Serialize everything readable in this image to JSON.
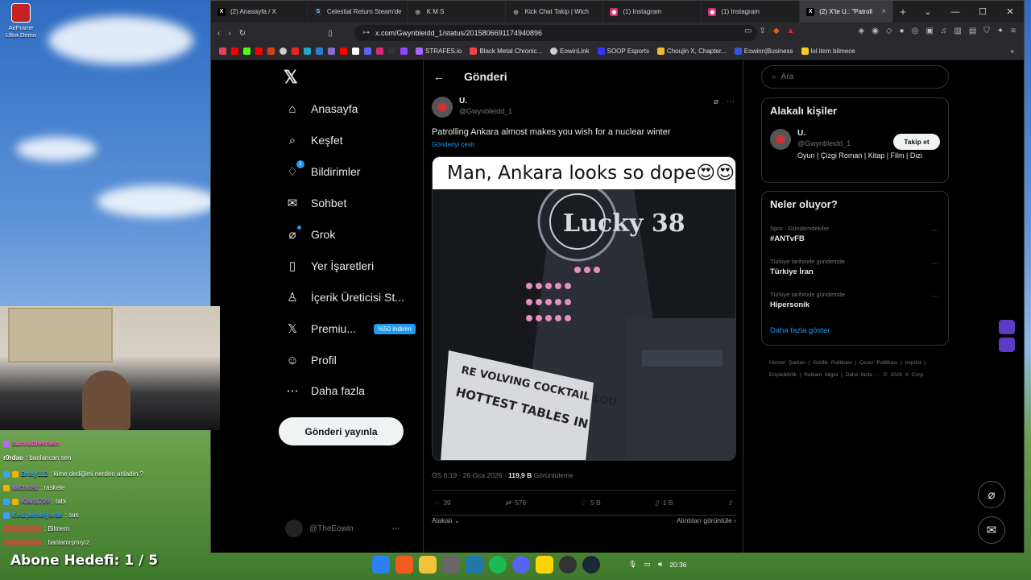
{
  "desktop": {
    "icon_label": "AirFrame Ultra Demo"
  },
  "browser": {
    "tabs": [
      {
        "label": "(2) Anasayfa / X",
        "color": "#000000",
        "glyph": "X"
      },
      {
        "label": "Celestial Return Steam'de",
        "color": "#1b2838",
        "glyph": "S"
      },
      {
        "label": "K M S",
        "color": "#444444",
        "glyph": "◎"
      },
      {
        "label": "Kick Chat Takip | Wich",
        "color": "#444444",
        "glyph": "◎"
      },
      {
        "label": "(1) Instagram",
        "color": "#d62976",
        "glyph": "◉"
      },
      {
        "label": "(1) Instagram",
        "color": "#d62976",
        "glyph": "◉"
      },
      {
        "label": "(2) X'te U.: \"Patroll",
        "color": "#000000",
        "glyph": "X"
      }
    ],
    "url": "x.com/Gwynbleidd_1/status/2015806691174940896",
    "bookmarks": [
      "STRAFES.io",
      "Black Metal Chronic...",
      "EowinLink",
      "SOOP Esports",
      "Choujin X, Chapter...",
      "Eowinn|Business",
      "lol item bilmece"
    ]
  },
  "nav": {
    "items": [
      {
        "label": "Anasayfa",
        "icon": "home-icon",
        "glyph": "⌂"
      },
      {
        "label": "Keşfet",
        "icon": "search-icon",
        "glyph": "⌕"
      },
      {
        "label": "Bildirimler",
        "icon": "bell-icon",
        "glyph": "🔔︎",
        "badge": "2"
      },
      {
        "label": "Sohbet",
        "icon": "mail-icon",
        "glyph": "✉"
      },
      {
        "label": "Grok",
        "icon": "grok-icon",
        "glyph": "⌀"
      },
      {
        "label": "Yer İşaretleri",
        "icon": "bookmark-icon",
        "glyph": "▯"
      },
      {
        "label": "İçerik Üreticisi St...",
        "icon": "creator-icon",
        "glyph": "♙"
      },
      {
        "label": "Premiu...",
        "icon": "x-premium-icon",
        "glyph": "𝕏",
        "promo": "%50 indirim"
      },
      {
        "label": "Profil",
        "icon": "profile-icon",
        "glyph": "☺"
      },
      {
        "label": "Daha fazla",
        "icon": "more-icon",
        "glyph": "⋯"
      }
    ],
    "post_button": "Gönderi yayınla",
    "account_handle": "@TheEowin"
  },
  "main": {
    "header": "Gönderi",
    "author_name": "U.",
    "author_handle": "@Gwynbleidd_1",
    "post_text": "Patrolling Ankara almost makes you wish for a nuclear winter",
    "translate": "Gönderiyi çevir",
    "image_caption": "Man, Ankara looks so dope😍😍",
    "image_sign_1": "RE VOLVING COCKTAIL LOU",
    "image_sign_2": "HOTTEST TABLES IN",
    "image_sign_3": "Lucky 38",
    "meta_time": "ÖS 6:19 · 26 Oca 2026 · ",
    "meta_views": "119,9 B",
    "meta_views_label": " Görüntüleme",
    "replies": "39",
    "reposts": "576",
    "likes": "5 B",
    "bookmarks": "1 B",
    "relevance": "Alakalı",
    "quotes_link": "Alıntıları görüntüle"
  },
  "right": {
    "search_placeholder": "Ara",
    "relevant_title": "Alakalı kişiler",
    "person_name": "U.",
    "person_handle": "@Gwynbleidd_1",
    "person_bio": "Oyun | Çizgi Roman | Kitap | Film | Dizi",
    "follow_button": "Takip et",
    "trending_title": "Neler oluyor?",
    "trends": [
      {
        "category": "Spor · Gündemdekiler",
        "title": "#ANTvFB"
      },
      {
        "category": "Türkiye tarihinde gündemde",
        "title": "Türkiye İran"
      },
      {
        "category": "Türkiye tarihinde gündemde",
        "title": "Hipersonik"
      }
    ],
    "show_more": "Daha fazla göster",
    "footer": "Hizmet Şartları | Gizlilik Politikası | Çerez Politikası | Imprint | Erişilebilirlik | Reklam bilgisi | Daha fazla ··· © 2026 X Corp."
  },
  "chat": [
    {
      "user": "zumrutthetrash",
      "text": "",
      "color": "#ff66cc"
    },
    {
      "user": "r0rdao",
      "text": ": banlancan sen",
      "color": "#ffffff"
    },
    {
      "user": "Broly112",
      "text": ": kime dediğimi nerden anladın ?",
      "color": "#3aa0ff"
    },
    {
      "user": "wichlost",
      "text": ": raskele",
      "color": "#b36bff"
    },
    {
      "user": "Kiari1709",
      "text": ": tabi",
      "color": "#b36bff"
    },
    {
      "user": "Kediperhelyerde",
      "text": ": sus",
      "color": "#3aa0ff"
    },
    {
      "user": "",
      "text": ": Bilmem",
      "color": "#ff3333"
    },
    {
      "user": "",
      "text": ": banlamışmıyız",
      "color": "#ff3333"
    }
  ],
  "overlay": {
    "abone": "Abone Hedefi:   1 / 5"
  },
  "taskbar": {
    "time": "20:36"
  }
}
